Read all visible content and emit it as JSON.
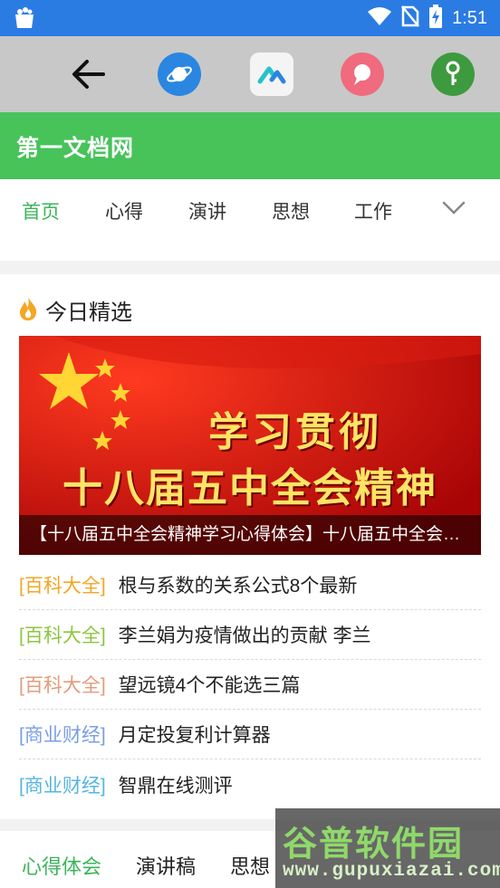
{
  "status_bar": {
    "time": "1:51",
    "icons": [
      "app-store-icon",
      "wifi-icon",
      "no-sim-icon",
      "battery-charging-icon"
    ]
  },
  "toolbar": {
    "items": [
      "back-arrow-icon",
      "browser-planet-icon",
      "app-store-icon",
      "chat-bubble-icon",
      "key-icon"
    ]
  },
  "brand": {
    "title": "第一文档网"
  },
  "nav_tabs": [
    {
      "label": "首页",
      "active": true
    },
    {
      "label": "心得",
      "active": false
    },
    {
      "label": "演讲",
      "active": false
    },
    {
      "label": "思想",
      "active": false
    },
    {
      "label": "工作",
      "active": false
    }
  ],
  "featured": {
    "heading": "今日精选",
    "banner": {
      "line1": "学习贯彻",
      "line2": "十八届五中全会精神",
      "caption": "【十八届五中全会精神学习心得体会】十八届五中全会精神学习心得体会"
    },
    "items": [
      {
        "category": "[百科大全]",
        "color": "#f3a623",
        "title": "根与系数的关系公式8个最新"
      },
      {
        "category": "[百科大全]",
        "color": "#8cc63f",
        "title": "李兰娟为疫情做出的贡献 李兰"
      },
      {
        "category": "[百科大全]",
        "color": "#e39b7b",
        "title": "望远镜4个不能选三篇"
      },
      {
        "category": "[商业财经]",
        "color": "#7a9ee6",
        "title": "月定投复利计算器"
      },
      {
        "category": "[商业财经]",
        "color": "#55b6e0",
        "title": "智鼎在线测评"
      }
    ]
  },
  "bottom_tabs": [
    {
      "label": "心得体会",
      "active": true
    },
    {
      "label": "演讲稿",
      "active": false
    },
    {
      "label": "思想",
      "active": false
    }
  ],
  "watermark": {
    "top": "谷普软件园",
    "bottom": "www.gupuxiazai.com"
  },
  "colors": {
    "status_bar": "#2a7ce3",
    "brand_green": "#47c35a",
    "active_tab": "#3cb55a",
    "toolbar_bg": "#c8c8c8"
  }
}
